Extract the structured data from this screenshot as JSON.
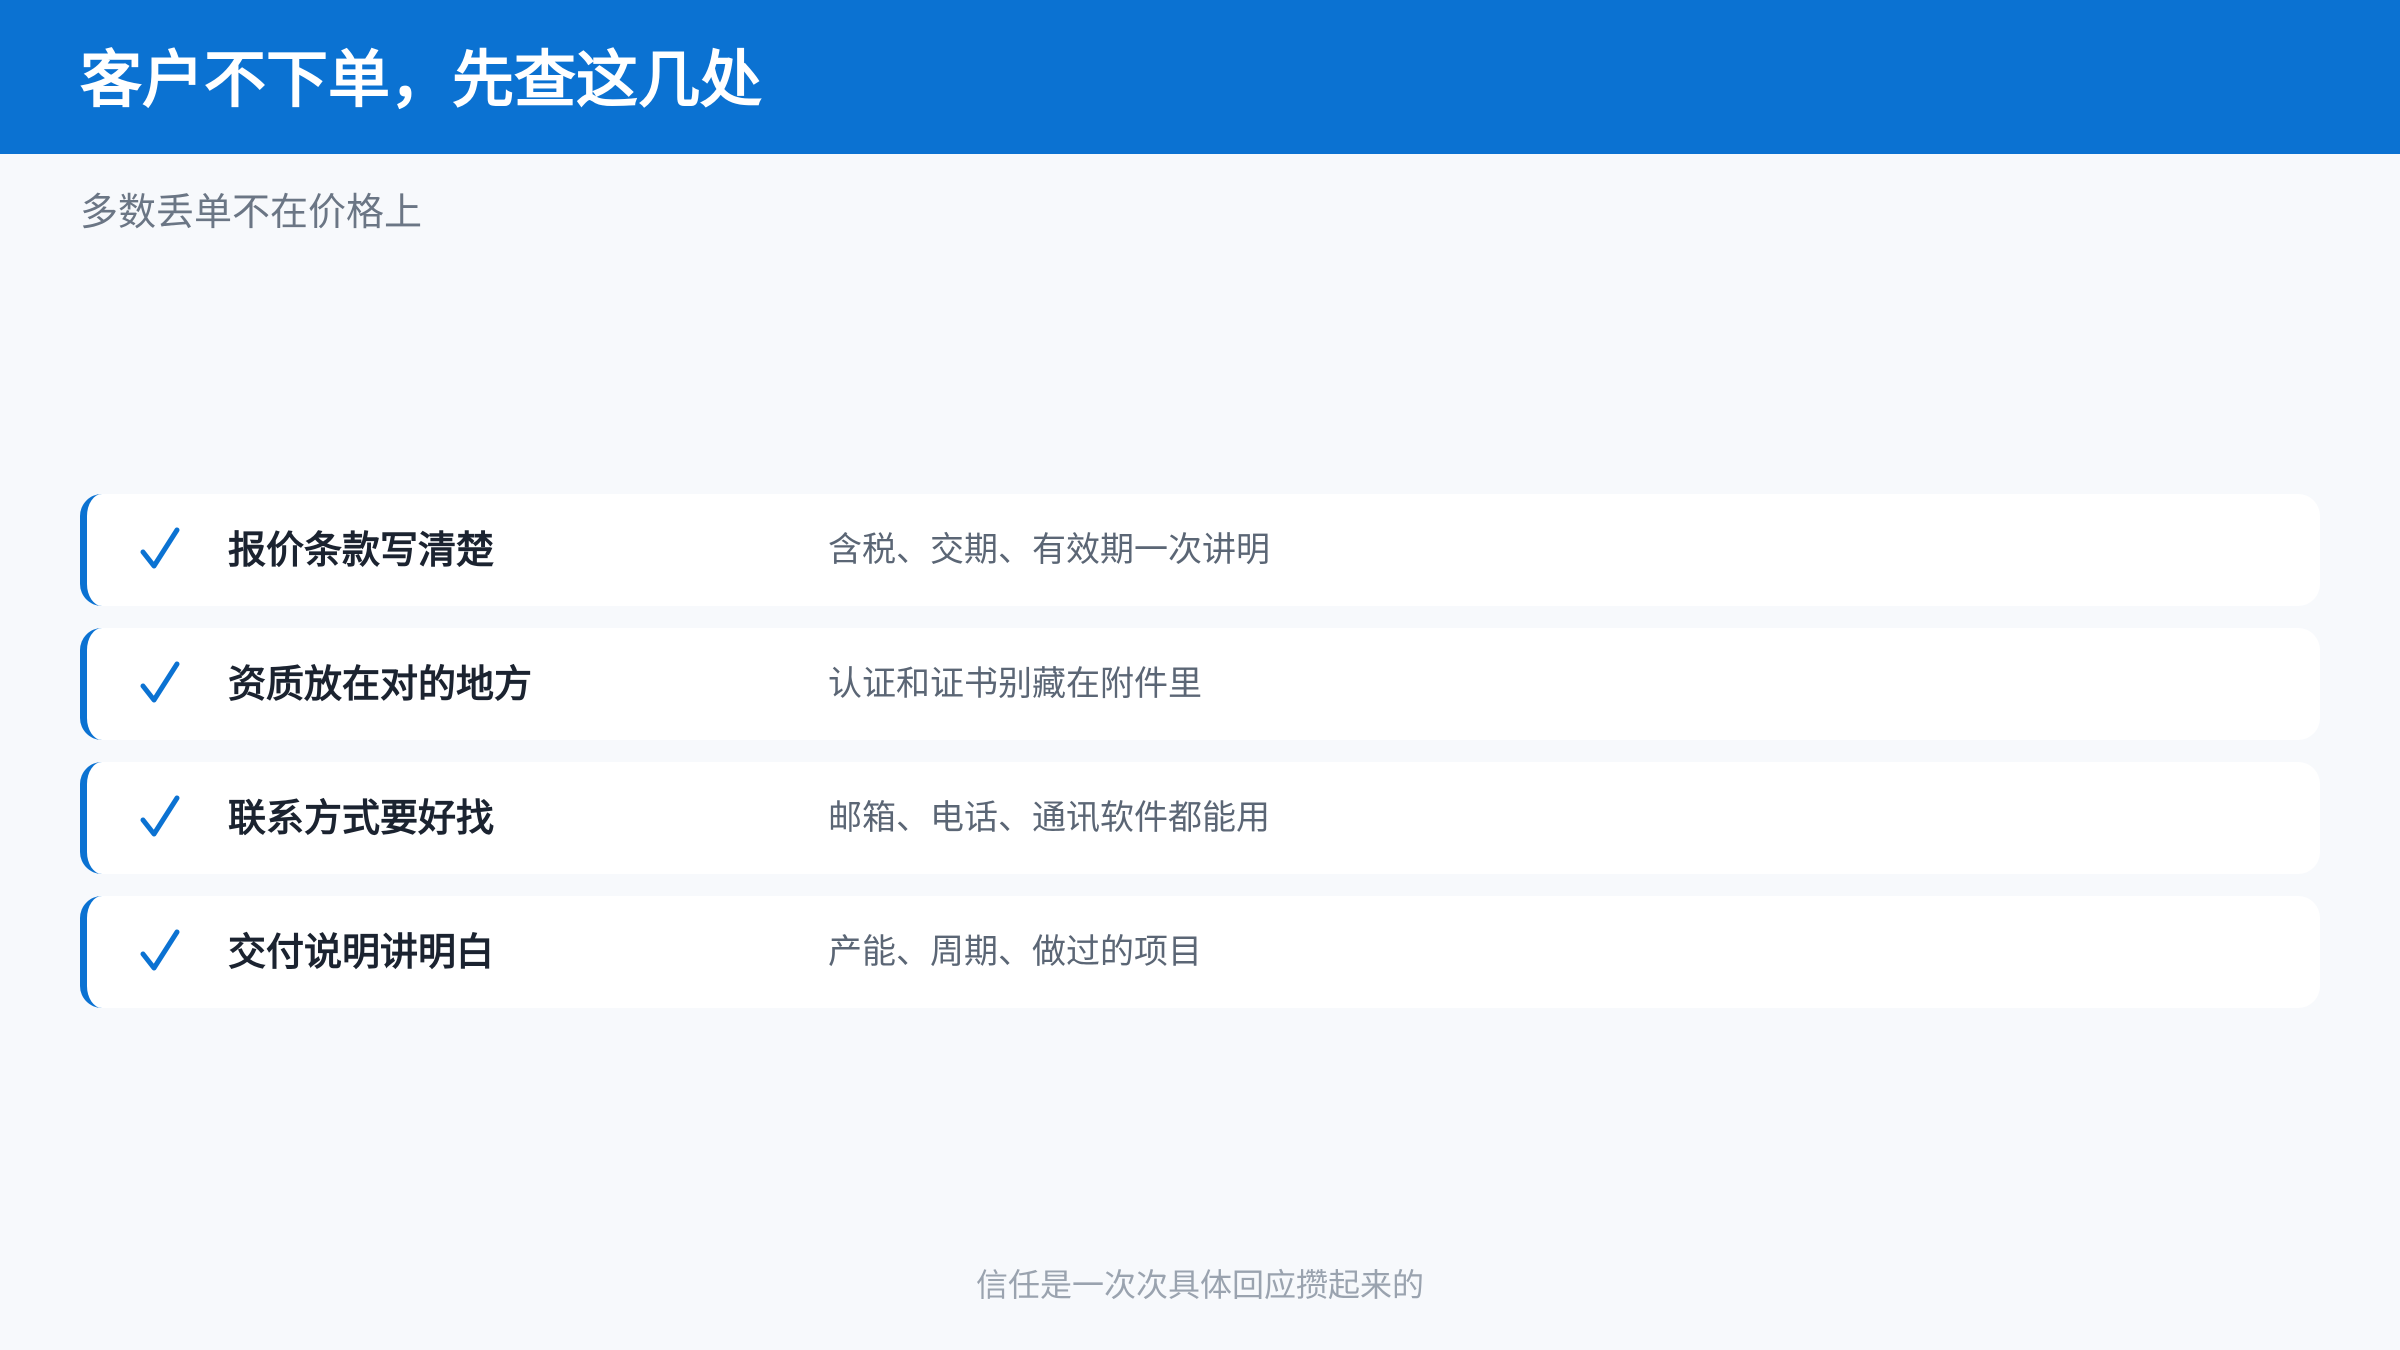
{
  "header": {
    "title": "客户不下单，先查这几处",
    "accent_color": "#0b72d2"
  },
  "subtitle": "多数丢单不在价格上",
  "checklist": {
    "icon": "check-icon",
    "items": [
      {
        "title": "报价条款写清楚",
        "description": "含税、交期、有效期一次讲明"
      },
      {
        "title": "资质放在对的地方",
        "description": "认证和证书别藏在附件里"
      },
      {
        "title": "联系方式要好找",
        "description": "邮箱、电话、通讯软件都能用"
      },
      {
        "title": "交付说明讲明白",
        "description": "产能、周期、做过的项目"
      }
    ]
  },
  "footer": {
    "note": "信任是一次次具体回应攒起来的"
  }
}
